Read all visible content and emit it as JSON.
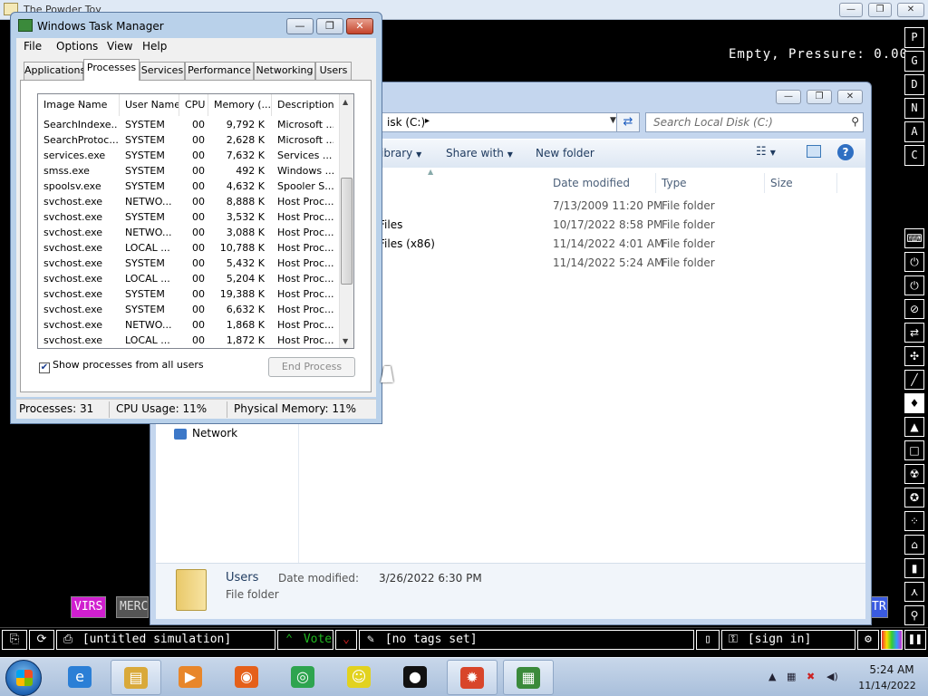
{
  "powder_toy": {
    "title": "The Powder Toy",
    "status": "Empty, Pressure: 0.00",
    "window_buttons": [
      "—",
      "❐",
      "✕"
    ],
    "side_letters": [
      "P",
      "G",
      "D",
      "N",
      "A",
      "C"
    ],
    "side_tools": [
      "⌨",
      "⏻",
      "⏻",
      "⊘",
      "⇄",
      "✣",
      "╱",
      "♦",
      "▲",
      "□",
      "☢",
      "✪",
      "⁘",
      "⌂",
      "▮",
      "⋏",
      "⚲"
    ],
    "elements": {
      "virs": "VIRS",
      "merc": "MERC",
      "tr": "TR"
    },
    "bottom": {
      "save_name": "[untitled simulation]",
      "vote": "Vote",
      "tags": "[no tags set]",
      "sign_in": "[sign in]"
    }
  },
  "explorer": {
    "address": "isk (C:)",
    "search_placeholder": "Search Local Disk (C:)",
    "toolbar": {
      "library": "ibrary",
      "share_with": "Share with",
      "new_folder": "New folder"
    },
    "columns": {
      "date_modified": "Date modified",
      "type": "Type",
      "size": "Size"
    },
    "rows": [
      {
        "name": "",
        "date": "7/13/2009 11:20 PM",
        "type": "File folder"
      },
      {
        "name": "Files",
        "date": "10/17/2022 8:58 PM",
        "type": "File folder"
      },
      {
        "name": "Files (x86)",
        "date": "11/14/2022 4:01 AM",
        "type": "File folder"
      },
      {
        "name": "",
        "date": "11/14/2022 5:24 AM",
        "type": "File folder"
      }
    ],
    "nav_network": "Network",
    "details": {
      "name": "Users",
      "modified_label": "Date modified:",
      "modified_value": "3/26/2022 6:30 PM",
      "type": "File folder"
    }
  },
  "taskmgr": {
    "title": "Windows Task Manager",
    "menu": [
      "File",
      "Options",
      "View",
      "Help"
    ],
    "tabs": [
      "Applications",
      "Processes",
      "Services",
      "Performance",
      "Networking",
      "Users"
    ],
    "active_tab": "Processes",
    "columns": [
      "Image Name",
      "User Name",
      "CPU",
      "Memory (...",
      "Description"
    ],
    "processes": [
      [
        "SearchIndexe...",
        "SYSTEM",
        "00",
        "9,792 K",
        "Microsoft ..."
      ],
      [
        "SearchProtoc...",
        "SYSTEM",
        "00",
        "2,628 K",
        "Microsoft ..."
      ],
      [
        "services.exe",
        "SYSTEM",
        "00",
        "7,632 K",
        "Services ..."
      ],
      [
        "smss.exe",
        "SYSTEM",
        "00",
        "492 K",
        "Windows ..."
      ],
      [
        "spoolsv.exe",
        "SYSTEM",
        "00",
        "4,632 K",
        "Spooler S..."
      ],
      [
        "svchost.exe",
        "NETWO...",
        "00",
        "8,888 K",
        "Host Proc..."
      ],
      [
        "svchost.exe",
        "SYSTEM",
        "00",
        "3,532 K",
        "Host Proc..."
      ],
      [
        "svchost.exe",
        "NETWO...",
        "00",
        "3,088 K",
        "Host Proc..."
      ],
      [
        "svchost.exe",
        "LOCAL ...",
        "00",
        "10,788 K",
        "Host Proc..."
      ],
      [
        "svchost.exe",
        "SYSTEM",
        "00",
        "5,432 K",
        "Host Proc..."
      ],
      [
        "svchost.exe",
        "LOCAL ...",
        "00",
        "5,204 K",
        "Host Proc..."
      ],
      [
        "svchost.exe",
        "SYSTEM",
        "00",
        "19,388 K",
        "Host Proc..."
      ],
      [
        "svchost.exe",
        "SYSTEM",
        "00",
        "6,632 K",
        "Host Proc..."
      ],
      [
        "svchost.exe",
        "NETWO...",
        "00",
        "1,868 K",
        "Host Proc..."
      ],
      [
        "svchost.exe",
        "LOCAL ...",
        "00",
        "1,872 K",
        "Host Proc..."
      ]
    ],
    "show_all_label": "Show processes from all users",
    "show_all_checked": true,
    "end_process": "End Process",
    "status": {
      "processes": "Processes: 31",
      "cpu": "CPU Usage: 11%",
      "memory": "Physical Memory: 11%"
    }
  },
  "taskbar": {
    "apps": [
      {
        "name": "Internet Explorer",
        "icon": "ie-icon",
        "glyph": "e",
        "color": "#2b7fd6"
      },
      {
        "name": "Windows Explorer",
        "icon": "folder-icon",
        "glyph": "▤",
        "color": "#d9a93a"
      },
      {
        "name": "Media Player",
        "icon": "media-player-icon",
        "glyph": "▶",
        "color": "#e8862a"
      },
      {
        "name": "Firefox",
        "icon": "firefox-icon",
        "glyph": "◉",
        "color": "#e5601a"
      },
      {
        "name": "Chrome",
        "icon": "chrome-icon",
        "glyph": "◎",
        "color": "#2ea44f"
      },
      {
        "name": "SpongeBob",
        "icon": "spongebob-icon",
        "glyph": "☺",
        "color": "#e2d21e"
      },
      {
        "name": "Pingu",
        "icon": "pingu-icon",
        "glyph": "●",
        "color": "#111111"
      },
      {
        "name": "Powder Toy",
        "icon": "powder-toy-icon",
        "glyph": "✹",
        "color": "#d8452a"
      },
      {
        "name": "Task Manager",
        "icon": "task-manager-icon",
        "glyph": "▦",
        "color": "#3b8a3b"
      }
    ],
    "tray": {
      "time": "5:24 AM",
      "date": "11/14/2022"
    }
  }
}
